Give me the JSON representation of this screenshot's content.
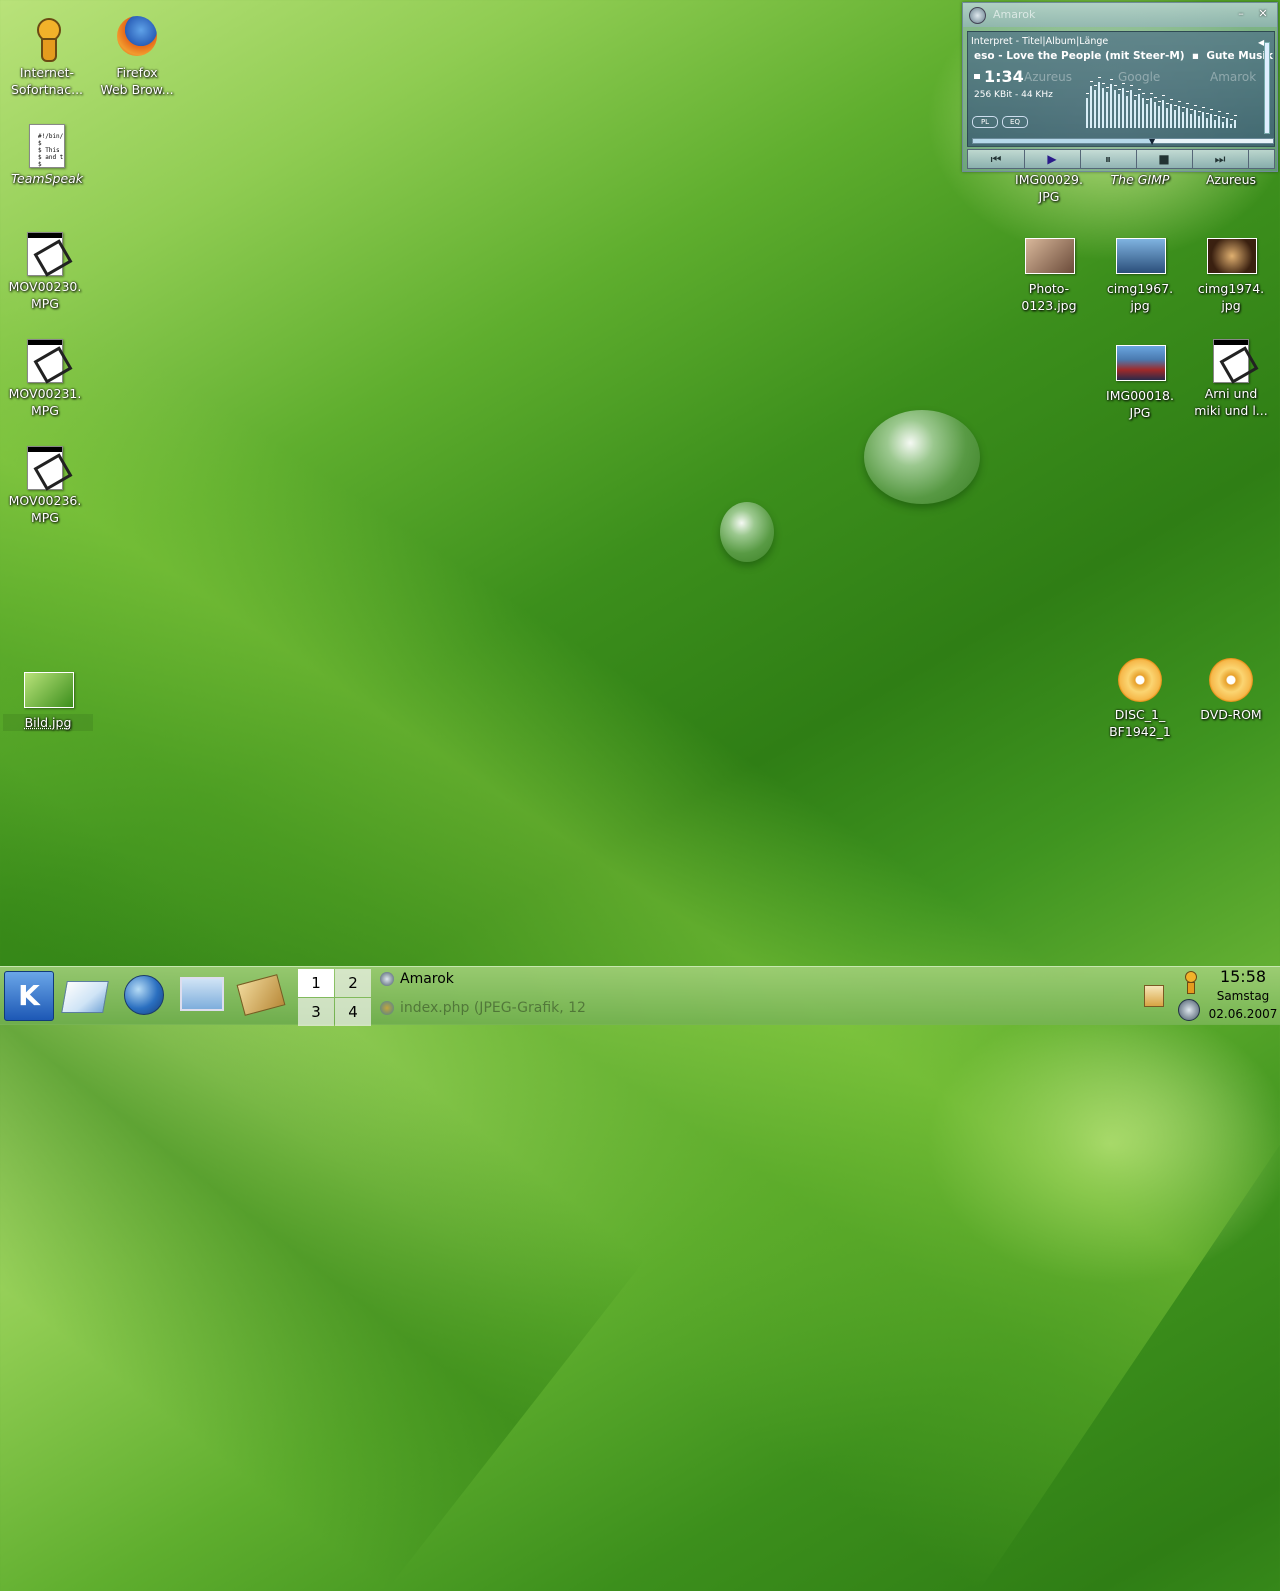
{
  "desktop": {
    "icons": [
      {
        "id": "kopete",
        "label": "Internet-\nSofortnac...",
        "type": "kopete-icon"
      },
      {
        "id": "firefox",
        "label": "Firefox\nWeb Brow...",
        "type": "firefox-icon"
      },
      {
        "id": "teamspeak",
        "label": "TeamSpeak",
        "type": "script-icon",
        "script": "#!/bin/\n$\n$ This\n$ and t\n$"
      },
      {
        "id": "mov230",
        "label": "MOV00230.\nMPG",
        "type": "video-file-icon"
      },
      {
        "id": "mov231",
        "label": "MOV00231.\nMPG",
        "type": "video-file-icon"
      },
      {
        "id": "mov236",
        "label": "MOV00236.\nMPG",
        "type": "video-file-icon"
      },
      {
        "id": "bild",
        "label": "Bild.jpg",
        "type": "image-file-icon"
      },
      {
        "id": "img29",
        "label": "IMG00029.\nJPG",
        "type": "image-file-icon"
      },
      {
        "id": "gimp",
        "label": "The GIMP",
        "type": "gimp-icon"
      },
      {
        "id": "azureus",
        "label": "Azureus",
        "type": "azureus-icon"
      },
      {
        "id": "photo123",
        "label": "Photo-\n0123.jpg",
        "type": "image-file-icon"
      },
      {
        "id": "cimg1967",
        "label": "cimg1967.\njpg",
        "type": "image-file-icon"
      },
      {
        "id": "cimg1974",
        "label": "cimg1974.\njpg",
        "type": "image-file-icon"
      },
      {
        "id": "img18",
        "label": "IMG00018.\nJPG",
        "type": "image-file-icon"
      },
      {
        "id": "arni",
        "label": "Arni und\nmiki und l...",
        "type": "video-file-icon"
      },
      {
        "id": "disc",
        "label": "DISC_1_\nBF1942_1",
        "type": "cdrom-icon"
      },
      {
        "id": "dvd",
        "label": "DVD-ROM",
        "type": "cdrom-icon"
      }
    ]
  },
  "amarok": {
    "title": "Amarok",
    "minimize": "–",
    "close": "✕",
    "header": "Interpret - Titel|Album|Länge",
    "track": "eso - Love the People (mit Steer-M)  ▪  Gute Musik  ▪",
    "time": "1:34",
    "bitrate": "256 KBit - 44 KHz",
    "pl_label": "PL",
    "eq_label": "EQ",
    "progress": 0.6,
    "ghost_labels": [
      "Azureus",
      "Google",
      "Amarok"
    ],
    "controls": {
      "prev": "⏮",
      "play": "▶",
      "pause": "⏸",
      "stop": "■",
      "next": "⏭"
    },
    "analyzer": [
      30,
      42,
      38,
      46,
      40,
      36,
      44,
      38,
      34,
      40,
      32,
      38,
      28,
      34,
      30,
      24,
      30,
      26,
      22,
      28,
      20,
      24,
      18,
      22,
      16,
      20,
      14,
      18,
      12,
      16,
      10,
      14,
      8,
      12,
      6,
      10,
      4,
      8
    ],
    "colors": {
      "display": "#557f93",
      "text": "#ffffff"
    }
  },
  "taskbar": {
    "kmenu_label": "K",
    "pager": [
      "1",
      "2",
      "3",
      "4"
    ],
    "active_desktop": "1",
    "tasks": [
      {
        "label": "Amarok",
        "icon": "amarok-icon",
        "dim": false
      },
      {
        "label": "index.php (JPEG-Grafik, 12",
        "icon": "firefox-icon",
        "dim": true
      }
    ],
    "clock": {
      "time": "15:58",
      "day": "Samstag",
      "date": "02.06.2007"
    }
  }
}
